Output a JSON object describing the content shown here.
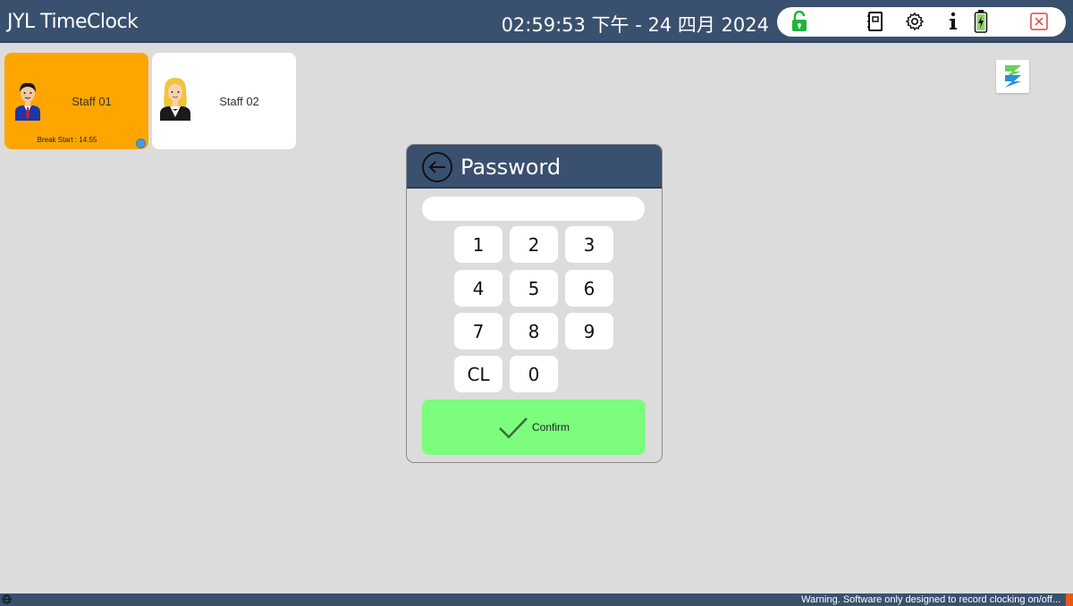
{
  "header": {
    "app_title": "JYL TimeClock",
    "clock": "02:59:53 下午 - 24 四月 2024"
  },
  "tray_icons": [
    "unlock-icon",
    "notebook-icon",
    "gear-icon",
    "info-icon",
    "battery-icon",
    "close-icon"
  ],
  "staff": [
    {
      "name": "Staff 01",
      "break_text": "Break Start : 14:55",
      "tile_color": "#ffa500"
    },
    {
      "name": "Staff 02",
      "break_text": "",
      "tile_color": "#ffffff"
    }
  ],
  "dialog": {
    "title": "Password",
    "password_value": "",
    "keys": [
      "1",
      "2",
      "3",
      "4",
      "5",
      "6",
      "7",
      "8",
      "9",
      "CL",
      "0"
    ],
    "confirm_label": "Confirm"
  },
  "statusbar": {
    "warning": "Warning. Software only designed to record clocking on/off..."
  },
  "colors": {
    "header_bg": "#3a506f",
    "confirm_bg": "#7dfd7d",
    "unlock_green": "#1fb53a",
    "close_red": "#e0443a"
  }
}
